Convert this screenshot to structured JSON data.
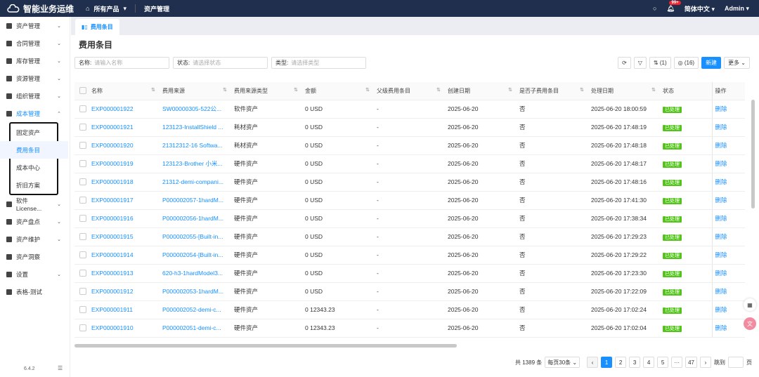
{
  "header": {
    "app_name": "智能业务运维",
    "products": "所有产品",
    "module": "资产管理",
    "notif_badge": "99+",
    "language": "简体中文",
    "user": "Admin"
  },
  "sidebar": {
    "items": [
      {
        "label": "资产管理",
        "chev": "⌄"
      },
      {
        "label": "合同管理",
        "chev": "⌄"
      },
      {
        "label": "库存管理",
        "chev": "⌄"
      },
      {
        "label": "资源管理",
        "chev": "⌄"
      },
      {
        "label": "组织管理",
        "chev": "⌄"
      },
      {
        "label": "成本管理",
        "chev": "⌃"
      }
    ],
    "sub": [
      "固定资产",
      "费用条目",
      "成本中心",
      "折旧方案"
    ],
    "items2": [
      {
        "label": "软件License...",
        "chev": "⌄"
      },
      {
        "label": "资产盘点",
        "chev": "⌄"
      },
      {
        "label": "资产维护",
        "chev": "⌄"
      },
      {
        "label": "资产洞察",
        "chev": ""
      },
      {
        "label": "设置",
        "chev": "⌄"
      },
      {
        "label": "表格-测试",
        "chev": ""
      }
    ],
    "version": "6.4.2"
  },
  "tab": {
    "label": "费用条目"
  },
  "page": {
    "title": "费用条目"
  },
  "filters": [
    {
      "label": "名称:",
      "placeholder": "请输入名称"
    },
    {
      "label": "状态:",
      "placeholder": "请选择状态"
    },
    {
      "label": "类型:",
      "placeholder": "请选择类型"
    }
  ],
  "toolbar": {
    "sort": "⇅ (1)",
    "columns": "◎ (16)",
    "new": "新建",
    "more": "更多 ⌄"
  },
  "table": {
    "columns": [
      "名称",
      "费用来源",
      "费用来源类型",
      "金额",
      "父级费用条目",
      "创建日期",
      "是否子费用条目",
      "处理日期",
      "状态",
      "操作"
    ],
    "rows": [
      [
        "EXP000001922",
        "SW00000305-522公...",
        "软件资产",
        "0 USD",
        "-",
        "2025-06-20",
        "否",
        "2025-06-20 18:00:59",
        "已处理",
        "删除"
      ],
      [
        "EXP000001921",
        "123123-InstallShield ...",
        "耗材资产",
        "0 USD",
        "-",
        "2025-06-20",
        "否",
        "2025-06-20 17:48:19",
        "已处理",
        "删除"
      ],
      [
        "EXP000001920",
        "21312312-16 Softwa...",
        "耗材资产",
        "0 USD",
        "-",
        "2025-06-20",
        "否",
        "2025-06-20 17:48:18",
        "已处理",
        "删除"
      ],
      [
        "EXP000001919",
        "123123-Brother 小米...",
        "硬件资产",
        "0 USD",
        "-",
        "2025-06-20",
        "否",
        "2025-06-20 17:48:17",
        "已处理",
        "删除"
      ],
      [
        "EXP000001918",
        "21312-demi-compani...",
        "硬件资产",
        "0 USD",
        "-",
        "2025-06-20",
        "否",
        "2025-06-20 17:48:16",
        "已处理",
        "删除"
      ],
      [
        "EXP000001917",
        "P000002057-1hardM...",
        "硬件资产",
        "0 USD",
        "-",
        "2025-06-20",
        "否",
        "2025-06-20 17:41:30",
        "已处理",
        "删除"
      ],
      [
        "EXP000001916",
        "P000002056-1hardM...",
        "硬件资产",
        "0 USD",
        "-",
        "2025-06-20",
        "否",
        "2025-06-20 17:38:34",
        "已处理",
        "删除"
      ],
      [
        "EXP000001915",
        "P000002055-[Built-in...",
        "硬件资产",
        "0 USD",
        "-",
        "2025-06-20",
        "否",
        "2025-06-20 17:29:23",
        "已处理",
        "删除"
      ],
      [
        "EXP000001914",
        "P000002054-[Built-in...",
        "硬件资产",
        "0 USD",
        "-",
        "2025-06-20",
        "否",
        "2025-06-20 17:29:22",
        "已处理",
        "删除"
      ],
      [
        "EXP000001913",
        "620-h3-1hardModel3...",
        "硬件资产",
        "0 USD",
        "-",
        "2025-06-20",
        "否",
        "2025-06-20 17:23:30",
        "已处理",
        "删除"
      ],
      [
        "EXP000001912",
        "P000002053-1hardM...",
        "硬件资产",
        "0 USD",
        "-",
        "2025-06-20",
        "否",
        "2025-06-20 17:22:09",
        "已处理",
        "删除"
      ],
      [
        "EXP000001911",
        "P000002052-demi-c...",
        "硬件资产",
        "0 12343.23",
        "-",
        "2025-06-20",
        "否",
        "2025-06-20 17:02:24",
        "已处理",
        "删除"
      ],
      [
        "EXP000001910",
        "P000002051-demi-c...",
        "硬件资产",
        "0 12343.23",
        "-",
        "2025-06-20",
        "否",
        "2025-06-20 17:02:04",
        "已处理",
        "删除"
      ]
    ]
  },
  "pagination": {
    "total": "共 1389 条",
    "page_size": "每页30条 ⌄",
    "prev": "‹",
    "pages": [
      "1",
      "2",
      "3",
      "4",
      "5",
      "···",
      "47"
    ],
    "next": "›",
    "jump": "跳到",
    "page_unit": "页",
    "current": "1"
  },
  "colors": {
    "accent": "#1890ff",
    "header_bg": "#1f2f4d",
    "status": "#52c41a"
  }
}
